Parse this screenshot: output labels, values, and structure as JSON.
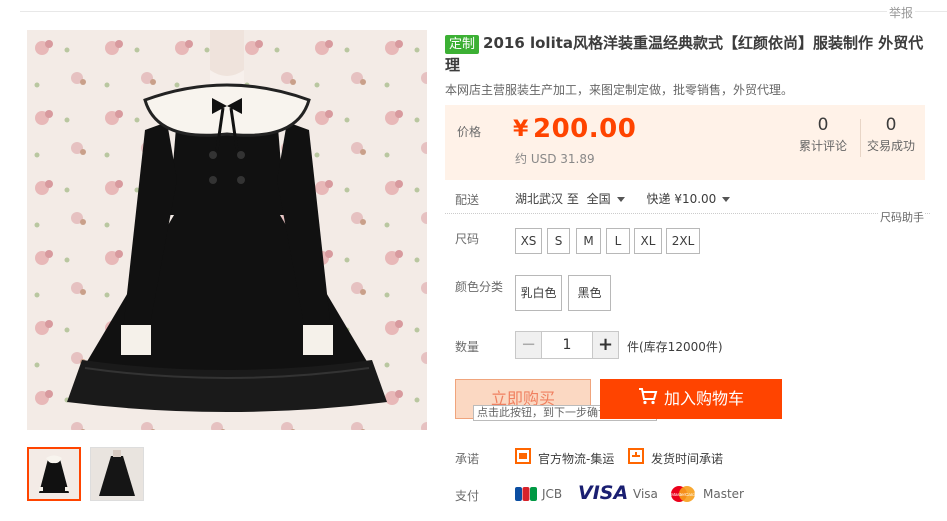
{
  "header": {
    "report_label": "举报"
  },
  "product": {
    "badge": "定制",
    "title": "2016 lolita风格洋装重温经典款式【红颜依尚】服装制作 外贸代理",
    "subtitle": "本网店主营服装生产加工，来图定制定做，批零销售，外贸代理。"
  },
  "price": {
    "label": "价格",
    "currency": "¥",
    "value": "200.00",
    "usd": "约 USD 31.89",
    "stats": [
      {
        "count": "0",
        "label": "累计评论"
      },
      {
        "count": "0",
        "label": "交易成功"
      }
    ]
  },
  "shipping": {
    "label": "配送",
    "origin": "湖北武汉 至",
    "destination": "全国",
    "method": "快递 ¥10.00"
  },
  "size": {
    "label": "尺码",
    "helper": "尺码助手",
    "options": [
      "XS",
      "S",
      "M",
      "L",
      "XL",
      "2XL"
    ]
  },
  "color": {
    "label": "颜色分类",
    "options": [
      "乳白色",
      "黑色"
    ]
  },
  "quantity": {
    "label": "数量",
    "minus": "−",
    "value": "1",
    "plus": "+",
    "stock": "件(库存12000件)"
  },
  "actions": {
    "buy_now": "立即购买",
    "buy_tooltip": "点击此按钮，到下一步确认购买信息",
    "add_cart": "加入购物车"
  },
  "promise": {
    "label": "承诺",
    "items": [
      "官方物流-集运",
      "发货时间承诺"
    ]
  },
  "payment": {
    "label": "支付",
    "jcb": "JCB",
    "visa_logo": "VISA",
    "visa": "Visa",
    "mastercard_logo": "MasterCard",
    "master": "Master"
  },
  "colors": {
    "accent": "#ff4400",
    "badge_green": "#3cb034",
    "price_bg": "#fff2e8"
  }
}
